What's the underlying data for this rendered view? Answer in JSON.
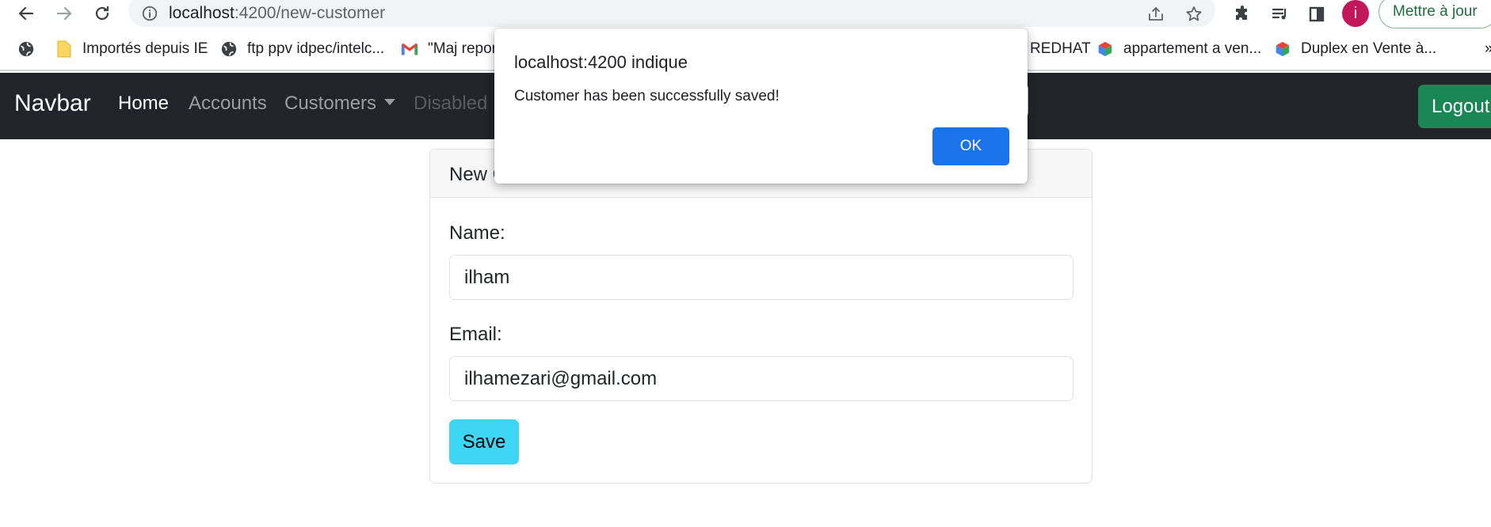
{
  "browser": {
    "url_host": "localhost",
    "url_path": ":4200/new-customer",
    "update_label": "Mettre à jour",
    "profile_initial": "i"
  },
  "bookmarks": [
    {
      "label": "",
      "icon": "globe-icon"
    },
    {
      "label": "Importés depuis IE",
      "icon": "folder-icon"
    },
    {
      "label": "ftp ppv idpec/intelc...",
      "icon": "globe-icon"
    },
    {
      "label": "\"Maj repor",
      "icon": "gmail-icon"
    },
    {
      "label": "REDHAT",
      "icon": ""
    },
    {
      "label": "appartement a ven...",
      "icon": "cube-icon"
    },
    {
      "label": "Duplex en Vente à...",
      "icon": "cube-icon"
    }
  ],
  "navbar": {
    "brand": "Navbar",
    "links": [
      "Home",
      "Accounts",
      "Customers",
      "Disabled"
    ],
    "logout": "Logout"
  },
  "form": {
    "title": "New C",
    "name_label": "Name:",
    "name_value": "ilham",
    "email_label": "Email:",
    "email_value": "ilhamezari@gmail.com",
    "save_label": "Save"
  },
  "dialog": {
    "title": "localhost:4200 indique",
    "message": "Customer has been successfully saved!",
    "ok_label": "OK"
  },
  "colors": {
    "navbar_bg": "#212529",
    "logout_bg": "#198754",
    "save_bg": "#3dd5f3",
    "ok_bg": "#1a73e8",
    "avatar_bg": "#c2185b"
  }
}
